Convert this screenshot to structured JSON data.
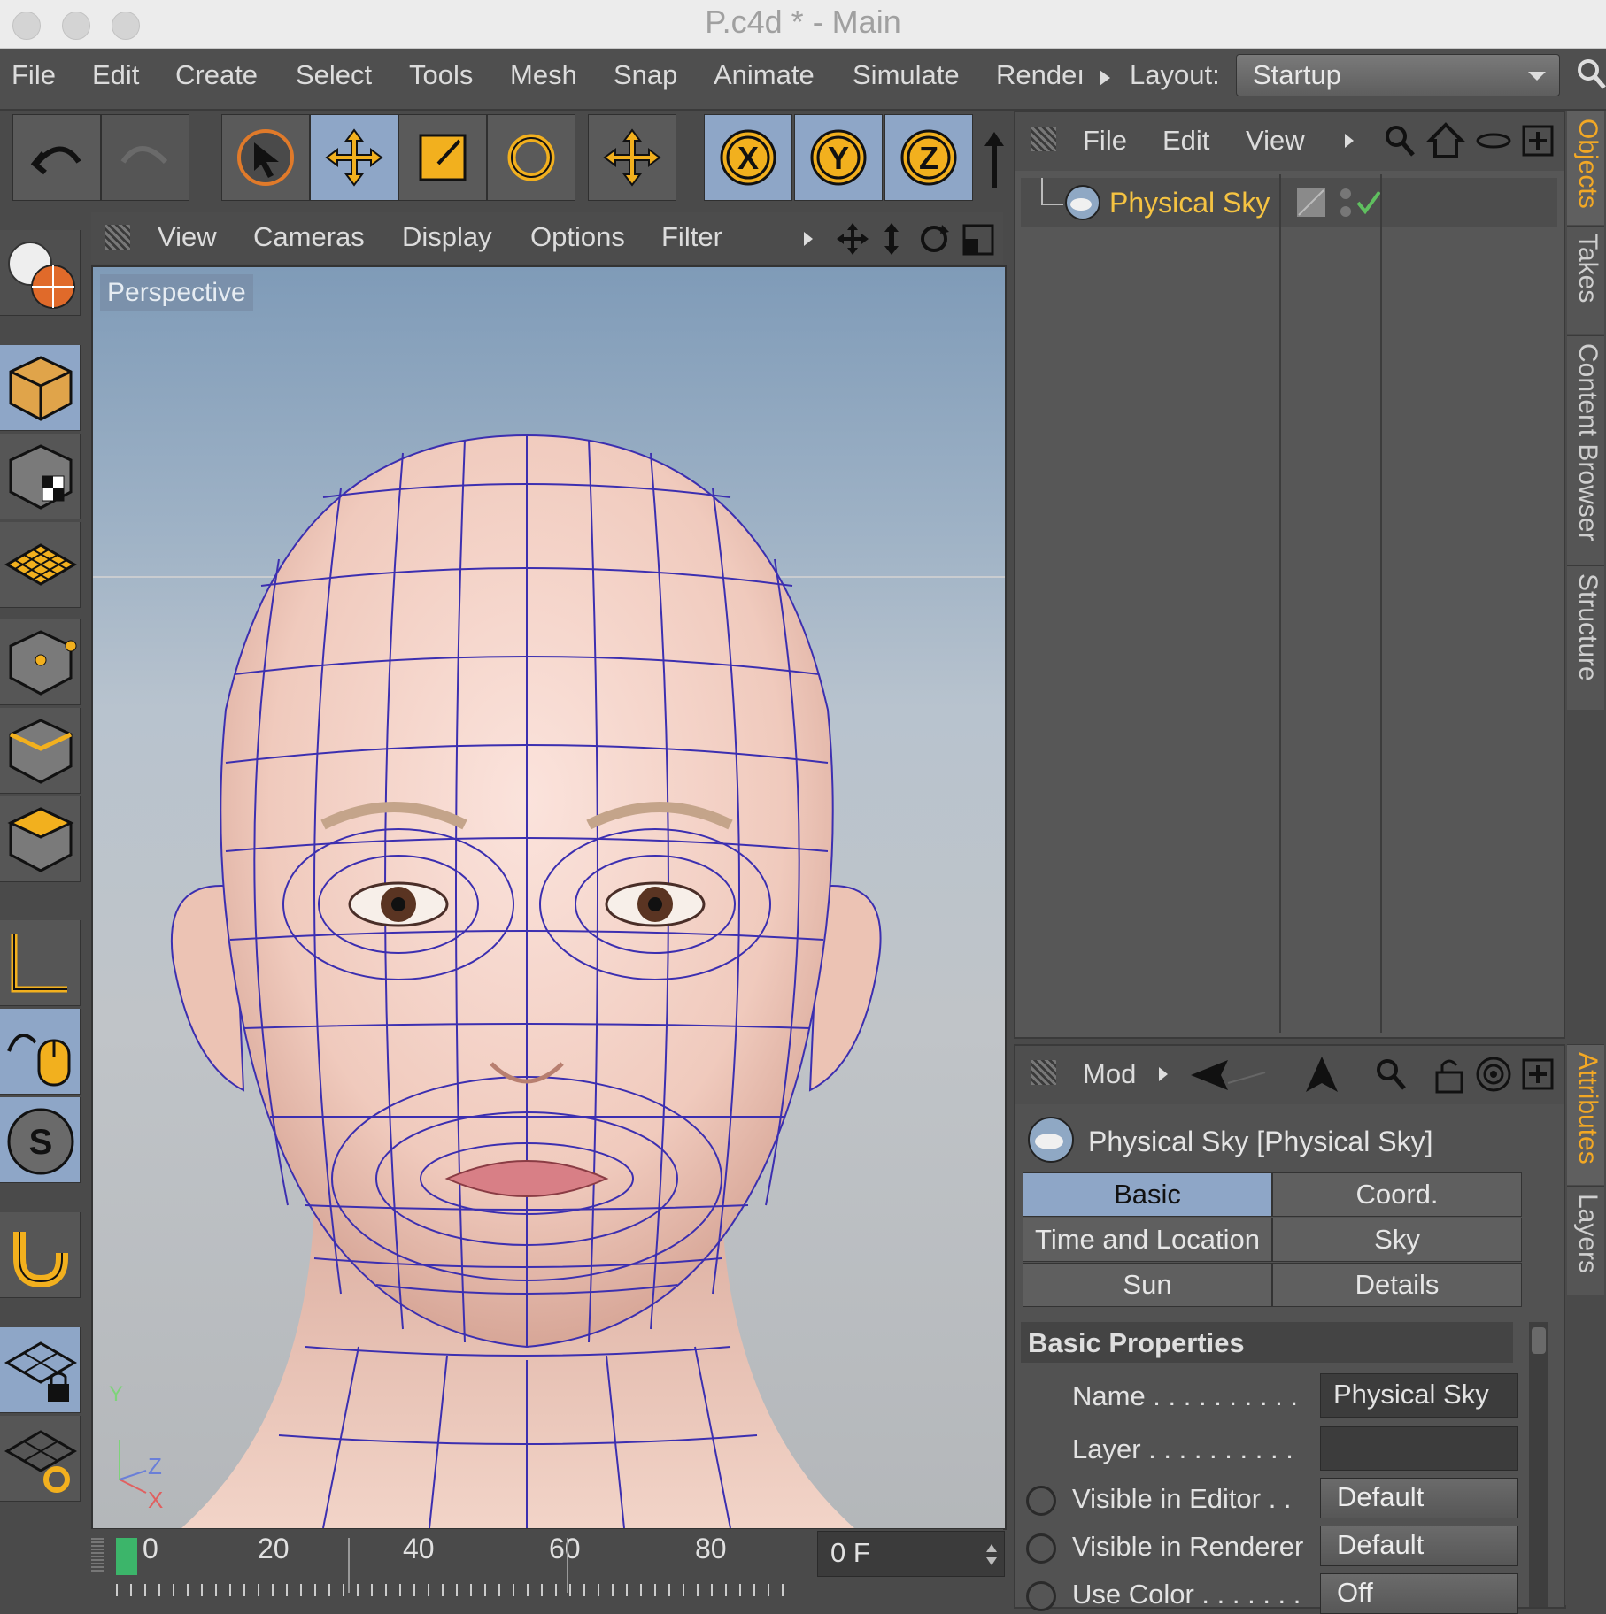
{
  "window": {
    "title": "P.c4d * - Main"
  },
  "menubar": {
    "items": [
      "File",
      "Edit",
      "Create",
      "Select",
      "Tools",
      "Mesh",
      "Snap",
      "Animate",
      "Simulate",
      "Rendeı"
    ],
    "layout_label": "Layout:",
    "layout_value": "Startup"
  },
  "viewport": {
    "menu": [
      "View",
      "Cameras",
      "Display",
      "Options",
      "Filter"
    ],
    "camera_label": "Perspective",
    "axis": {
      "x": "X",
      "y": "Y",
      "z": "Z"
    }
  },
  "timeline": {
    "ticks": [
      "0",
      "20",
      "40",
      "60",
      "80"
    ],
    "frame_value": "0 F"
  },
  "objects_panel": {
    "menu": [
      "File",
      "Edit",
      "View"
    ],
    "object_name": "Physical Sky"
  },
  "attributes_panel": {
    "menu_label": "Mod",
    "title": "Physical Sky [Physical Sky]",
    "tabs": [
      "Basic",
      "Coord.",
      "Time and Location",
      "Sky",
      "Sun",
      "Details"
    ],
    "section_title": "Basic Properties",
    "props": {
      "name_label": "Name . . . . . . . . . .",
      "name_value": "Physical Sky",
      "layer_label": "Layer . . . . . . . . . .",
      "visible_editor_label": "Visible in Editor . .",
      "visible_editor_value": "Default",
      "visible_renderer_label": "Visible in Renderer",
      "visible_renderer_value": "Default",
      "use_color_label": "Use Color . . . . . . .",
      "use_color_value": "Off"
    }
  },
  "side_tabs": {
    "top": [
      "Objects",
      "Takes",
      "Content Browser",
      "Structure"
    ],
    "bottom": [
      "Attributes",
      "Layers"
    ]
  },
  "colors": {
    "accent": "#f2a825",
    "selected": "#8ea6c7",
    "wire": "#3c2fb0"
  }
}
